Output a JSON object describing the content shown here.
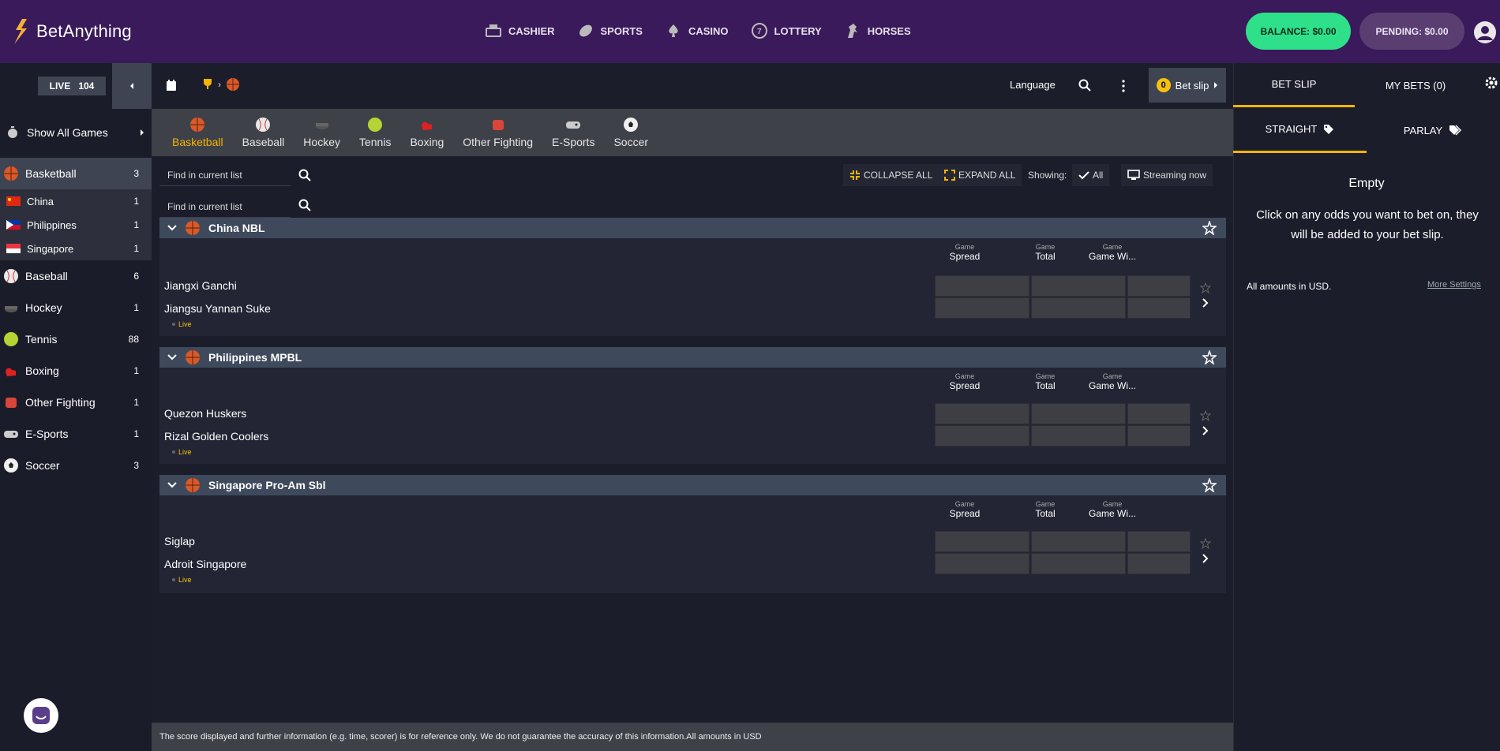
{
  "brand": {
    "name": "BetAnything"
  },
  "topnav": [
    {
      "label": "CASHIER",
      "icon": "cashier-icon"
    },
    {
      "label": "SPORTS",
      "icon": "sports-icon"
    },
    {
      "label": "CASINO",
      "icon": "spade-icon"
    },
    {
      "label": "LOTTERY",
      "icon": "lottery-icon"
    },
    {
      "label": "HORSES",
      "icon": "horse-icon"
    }
  ],
  "account": {
    "balance_label": "BALANCE: $0.00",
    "pending_label": "PENDING: $0.00"
  },
  "live": {
    "label": "LIVE",
    "count": "104"
  },
  "sidebar": {
    "show_all": "Show All Games",
    "items": [
      {
        "label": "Basketball",
        "count": "3",
        "icon": "basketball-icon"
      },
      {
        "label": "Baseball",
        "count": "6",
        "icon": "baseball-icon"
      },
      {
        "label": "Hockey",
        "count": "1",
        "icon": "hockey-icon"
      },
      {
        "label": "Tennis",
        "count": "88",
        "icon": "tennis-icon"
      },
      {
        "label": "Boxing",
        "count": "1",
        "icon": "boxing-icon"
      },
      {
        "label": "Other Fighting",
        "count": "1",
        "icon": "fighting-icon"
      },
      {
        "label": "E-Sports",
        "count": "1",
        "icon": "gamepad-icon"
      },
      {
        "label": "Soccer",
        "count": "3",
        "icon": "soccer-icon"
      }
    ],
    "sub_items": [
      {
        "label": "China",
        "count": "1"
      },
      {
        "label": "Philippines",
        "count": "1"
      },
      {
        "label": "Singapore",
        "count": "1"
      }
    ]
  },
  "subbar": {
    "language": "Language",
    "betslip_label": "Bet slip",
    "betslip_count": "0"
  },
  "sport_tabs": [
    "Basketball",
    "Baseball",
    "Hockey",
    "Tennis",
    "Boxing",
    "Other Fighting",
    "E-Sports",
    "Soccer"
  ],
  "filters": {
    "find_placeholder": "Find in current list",
    "collapse_all": "COLLAPSE ALL",
    "expand_all": "EXPAND ALL",
    "showing_label": "Showing:",
    "all_label": "All",
    "streaming_label": "Streaming now"
  },
  "columns": {
    "game": "Game",
    "spread": "Spread",
    "total": "Total",
    "game_win": "Game Wi..."
  },
  "leagues": [
    {
      "name": "China NBL",
      "team1": "Jiangxi Ganchi",
      "team2": "Jiangsu Yannan Suke",
      "status": "Live"
    },
    {
      "name": "Philippines MPBL",
      "team1": "Quezon Huskers",
      "team2": "Rizal Golden Coolers",
      "status": "Live"
    },
    {
      "name": "Singapore Pro-Am Sbl",
      "team1": "Siglap",
      "team2": "Adroit Singapore",
      "status": "Live"
    }
  ],
  "footer": {
    "text": "The score displayed and further information (e.g. time, scorer) is for reference only. We do not guarantee the accuracy of this information.All amounts in USD"
  },
  "betslip_panel": {
    "tab_betslip": "BET SLIP",
    "tab_mybets": "MY BETS (0)",
    "tab_straight": "STRAIGHT",
    "tab_parlay": "PARLAY",
    "empty_title": "Empty",
    "empty_message": "Click on any odds you want to bet on, they will be added to your bet slip.",
    "amounts_note": "All amounts in USD.",
    "more_settings": "More Settings"
  },
  "colors": {
    "topbar": "#3a1a5a",
    "balance": "#2ee08a",
    "pending": "#5a3e72",
    "accent": "#f4b400",
    "league_header": "#3e4a5c"
  }
}
